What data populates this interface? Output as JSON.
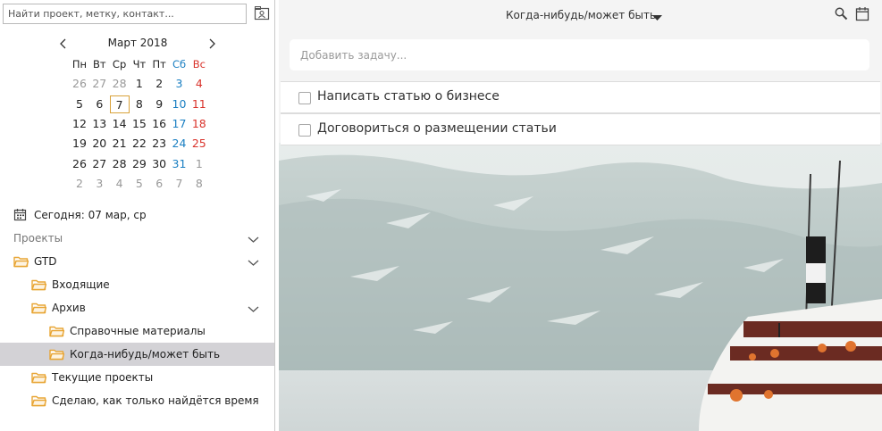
{
  "sidebar": {
    "search": {
      "placeholder": "Найти проект, метку, контакт..."
    },
    "calendar": {
      "month_label": "Март 2018",
      "weekdays": [
        "Пн",
        "Вт",
        "Ср",
        "Чт",
        "Пт",
        "Сб",
        "Вс"
      ],
      "weeks": [
        [
          "26",
          "27",
          "28",
          "1",
          "2",
          "3",
          "4"
        ],
        [
          "5",
          "6",
          "7",
          "8",
          "9",
          "10",
          "11"
        ],
        [
          "12",
          "13",
          "14",
          "15",
          "16",
          "17",
          "18"
        ],
        [
          "19",
          "20",
          "21",
          "22",
          "23",
          "24",
          "25"
        ],
        [
          "26",
          "27",
          "28",
          "29",
          "30",
          "31",
          "1"
        ],
        [
          "2",
          "3",
          "4",
          "5",
          "6",
          "7",
          "8"
        ]
      ],
      "selected_day": "7"
    },
    "today_label": "Сегодня: 07 мар, ср",
    "projects_header": "Проекты",
    "tree": [
      {
        "label": "GTD",
        "level": 0,
        "expanded": true
      },
      {
        "label": "Входящие",
        "level": 1
      },
      {
        "label": "Архив",
        "level": 1,
        "expanded": true
      },
      {
        "label": "Справочные материалы",
        "level": 2
      },
      {
        "label": "Когда-нибудь/может быть",
        "level": 2,
        "selected": true
      },
      {
        "label": "Текущие проекты",
        "level": 1
      },
      {
        "label": "Сделаю, как только найдётся время",
        "level": 1
      }
    ]
  },
  "main": {
    "view_title": "Когда-нибудь/может быть",
    "add_task_placeholder": "Добавить задачу...",
    "tasks": [
      {
        "label": "Написать статью о бизнесе",
        "done": false
      },
      {
        "label": "Договориться о размещении статьи",
        "done": false
      }
    ]
  },
  "colors": {
    "folder": "#e8a534",
    "saturday": "#1a7fc2",
    "sunday": "#d9332b",
    "today_border": "#d9a23a",
    "selected_row": "#d3d2d6"
  }
}
